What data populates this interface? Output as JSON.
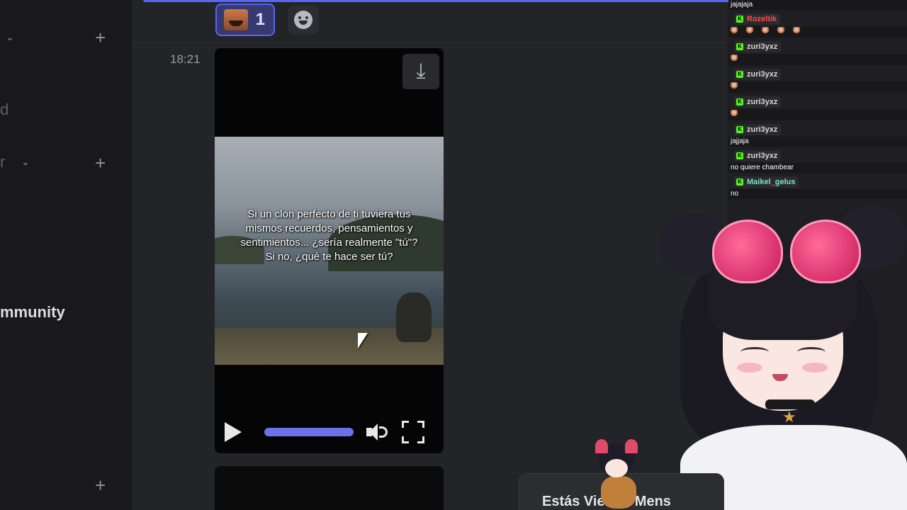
{
  "sidebar": {
    "partial_label_1": "d",
    "partial_label_2": "r",
    "community_label": "mmunity"
  },
  "message": {
    "reaction": {
      "count": "1"
    },
    "timestamp": "18:21",
    "video": {
      "caption": "Si un clon perfecto de ti tuviera tus mismos recuerdos, pensamientos y sentimientos... ¿sería realmente \"tú\"? Si no, ¿qué te hace ser tú?",
      "progress": 1.0
    }
  },
  "banner": {
    "text": "Estás Viendo Mens"
  },
  "stream_chat": {
    "messages": [
      {
        "user": "",
        "text": "jajajaja",
        "emotes": 0
      },
      {
        "user": "Rozeltik",
        "user_color": "#ff4d4d",
        "text": "",
        "emotes": 5
      },
      {
        "user": "zuri3yxz",
        "user_color": "#d7d7d7",
        "text": "",
        "emotes": 1
      },
      {
        "user": "zuri3yxz",
        "user_color": "#d7d7d7",
        "text": "",
        "emotes": 1
      },
      {
        "user": "zuri3yxz",
        "user_color": "#d7d7d7",
        "text": "",
        "emotes": 1
      },
      {
        "user": "zuri3yxz",
        "user_color": "#d7d7d7",
        "text": "jajjaja",
        "emotes": 0
      },
      {
        "user": "zuri3yxz",
        "user_color": "#d7d7d7",
        "text": "no quiere chambear",
        "emotes": 0
      },
      {
        "user": "Maikel_gelus",
        "user_color": "#7be3c8",
        "text": "no",
        "emotes": 0
      }
    ]
  },
  "colors": {
    "accent": "#5865f2",
    "kick_green": "#53fc18"
  }
}
